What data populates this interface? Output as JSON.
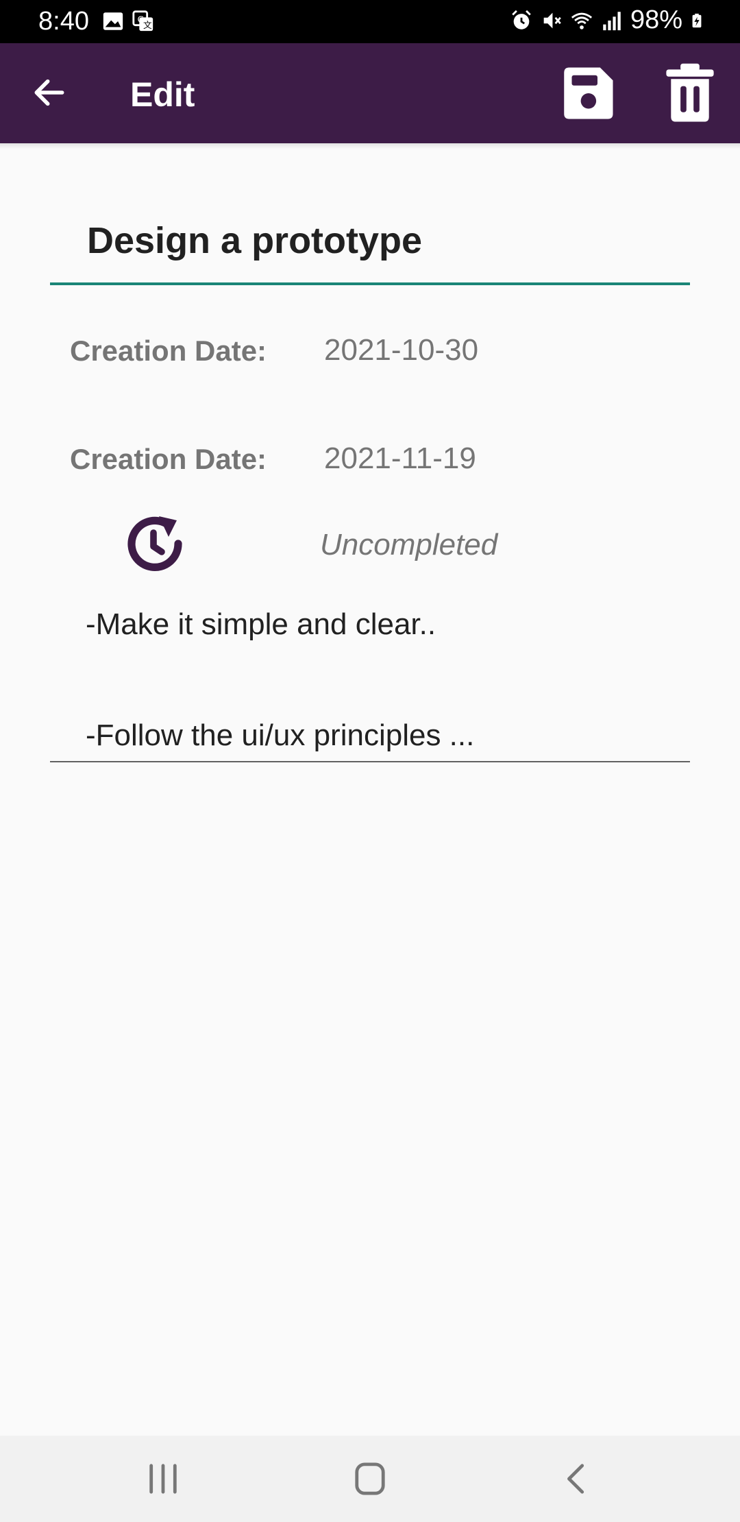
{
  "status_bar": {
    "time": "8:40",
    "battery": "98%",
    "left_icons": [
      "image-icon",
      "translate-icon"
    ],
    "right_icons": [
      "alarm-icon",
      "mute-icon",
      "wifi-icon",
      "signal-icon",
      "battery-charging-icon"
    ]
  },
  "app_bar": {
    "title": "Edit",
    "background_color": "#3d1c47",
    "actions": [
      "save-icon",
      "delete-icon"
    ]
  },
  "task": {
    "title": "Design a prototype",
    "dates": [
      {
        "label": "Creation Date:",
        "value": "2021-10-30"
      },
      {
        "label": "Creation Date:",
        "value": "2021-11-19"
      }
    ],
    "status": "Uncompleted",
    "status_icon": "clock-refresh-icon",
    "description_lines": [
      "-Make it simple and clear..",
      "-Follow the ui/ux principles ..."
    ],
    "accent_color": "#1a8577"
  },
  "nav_bar": {
    "buttons": [
      "recent-apps-icon",
      "home-icon",
      "back-icon"
    ]
  }
}
